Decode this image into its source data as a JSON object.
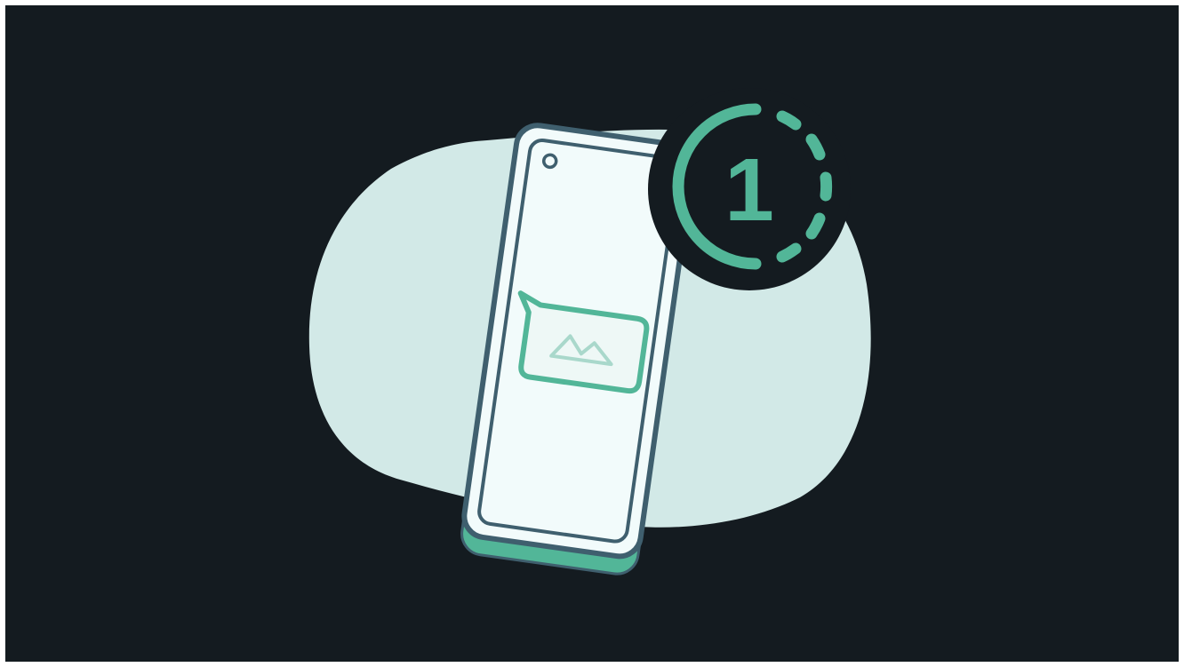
{
  "illustration": {
    "subject": "view-once-photo",
    "badge": {
      "number": "1",
      "icon": "timer-ring-icon"
    },
    "icons": [
      "phone-icon",
      "image-message-icon",
      "timer-ring-icon"
    ],
    "colors": {
      "background": "#141b20",
      "blob": "#d2e9e7",
      "phone_screen": "#f2fbfb",
      "phone_outline": "#3f5f6e",
      "accent": "#52b698",
      "image_stroke": "#a9d8cb"
    }
  }
}
